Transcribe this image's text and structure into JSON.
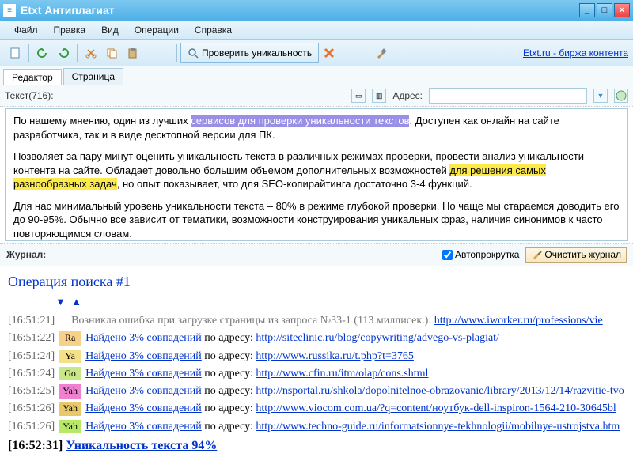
{
  "title": "Etxt Антиплагиат",
  "menu": {
    "file": "Файл",
    "edit": "Правка",
    "view": "Вид",
    "ops": "Операции",
    "help": "Справка"
  },
  "toolbar": {
    "check": "Проверить уникальность",
    "extlink": "Etxt.ru - биржа контента"
  },
  "tabs": {
    "editor": "Редактор",
    "page": "Страница"
  },
  "editor": {
    "textLabel": "Текст(716):",
    "addrLabel": "Адрес:",
    "addrValue": "",
    "p1a": "По нашему мнению, один из лучших ",
    "p1b": "сервисов для проверки уникальности текстов",
    "p1c": ". Доступен как онлайн на сайте разработчика, так и в виде десктопной версии для ПК.",
    "p2a": "Позволяет за пару минут оценить уникальность текста в различных режимах проверки, провести анализ уникальности контента на сайте. Обладает довольно большим объемом дополнительных возможностей ",
    "p2b": "для решения самых разнообразных задач",
    "p2c": ", но опыт показывает, что для SEO-копирайтинга достаточно 3-4 функций.",
    "p3": "Для нас минимальный уровень уникальности текста – 80% в режиме глубокой проверки. Но чаще мы стараемся доводить его до 90-95%. Обычно все зависит от тематики, возможности конструирования уникальных фраз, наличия синонимов к часто повторяющимся словам."
  },
  "log": {
    "title": "Журнал:",
    "autoscroll": "Автопрокрутка",
    "clear": "Очистить журнал",
    "opTitle": "Операция поиска #1",
    "errTs": "[16:51:21]",
    "errText": "Возникла ошибка при загрузке страницы из запроса №33-1 (113 миллисек.): ",
    "errUrl": "http://www.iworker.ru/professions/vie",
    "lines": [
      {
        "ts": "[16:51:22]",
        "se": "Ra",
        "cls": "se-ra",
        "found": "Найдено 3% совпадений",
        "byAddr": " по адресу: ",
        "url": "http://siteclinic.ru/blog/copywriting/advego-vs-plagiat/"
      },
      {
        "ts": "[16:51:24]",
        "se": "Ya",
        "cls": "se-ya1",
        "found": "Найдено 3% совпадений",
        "byAddr": " по адресу: ",
        "url": "http://www.russika.ru/t.php?t=3765"
      },
      {
        "ts": "[16:51:24]",
        "se": "Go",
        "cls": "se-go",
        "found": "Найдено 3% совпадений",
        "byAddr": " по адресу: ",
        "url": "http://www.cfin.ru/itm/olap/cons.shtml"
      },
      {
        "ts": "[16:51:25]",
        "se": "Yah",
        "cls": "se-yah1",
        "found": "Найдено 3% совпадений",
        "byAddr": " по адресу: ",
        "url": "http://nsportal.ru/shkola/dopolnitelnoe-obrazovanie/library/2013/12/14/razvitie-tvo"
      },
      {
        "ts": "[16:51:26]",
        "se": "Yah",
        "cls": "se-yah2",
        "found": "Найдено 3% совпадений",
        "byAddr": " по адресу: ",
        "url": "http://www.viocom.com.ua/?q=content/ноутбук-dell-inspiron-1564-210-30645bl"
      },
      {
        "ts": "[16:51:26]",
        "se": "Yah",
        "cls": "se-yah3",
        "found": "Найдено 3% совпадений",
        "byAddr": " по адресу: ",
        "url": "http://www.techno-guide.ru/informatsionnye-tekhnologii/mobilnye-ustrojstva.htm"
      }
    ],
    "resultTs": "[16:52:31] ",
    "resultText": "Уникальность текста 94%"
  }
}
